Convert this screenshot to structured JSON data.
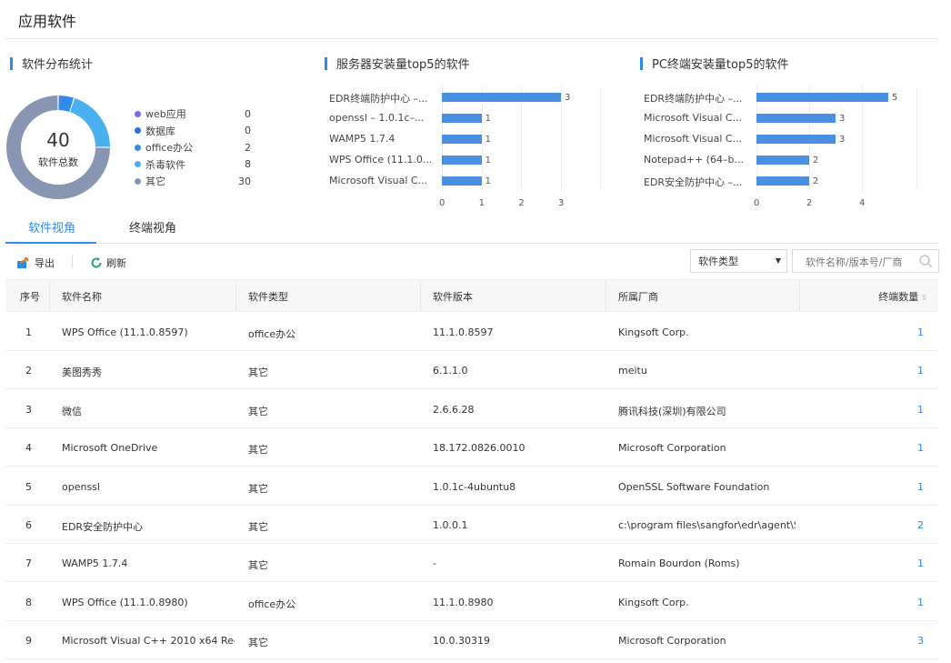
{
  "page": {
    "title": "应用软件"
  },
  "sections": {
    "distribution": "软件分布统计",
    "server_top5": "服务器安装量top5的软件",
    "pc_top5": "PC终端安装量top5的软件"
  },
  "donut": {
    "total": "40",
    "total_label": "软件总数"
  },
  "chart_data": [
    {
      "type": "pie",
      "categories": [
        "web应用",
        "数据库",
        "office办公",
        "杀毒软件",
        "其它"
      ],
      "values": [
        0,
        0,
        2,
        8,
        30
      ],
      "colors": [
        "#7b6cd9",
        "#2f6fd6",
        "#2f8be6",
        "#4ab0f0",
        "#8896b3"
      ],
      "legend_position": "right"
    },
    {
      "type": "bar",
      "orientation": "horizontal",
      "categories": [
        "EDR终端防护中心 –...",
        "openssl – 1.0.1c–...",
        "WAMP5 1.7.4",
        "WPS Office (11.1.0...",
        "Microsoft Visual C..."
      ],
      "values": [
        3,
        1,
        1,
        1,
        1
      ],
      "xlim": [
        0,
        3
      ],
      "xticks": [
        "0",
        "1",
        "2",
        "3"
      ],
      "color": "#4a90e2"
    },
    {
      "type": "bar",
      "orientation": "horizontal",
      "categories": [
        "EDR终端防护中心 –...",
        "Microsoft Visual C...",
        "Microsoft Visual C...",
        "Notepad++ (64–b...",
        "EDR安全防护中心 –..."
      ],
      "values": [
        5,
        3,
        3,
        2,
        2
      ],
      "xlim": [
        0,
        5
      ],
      "xticks": [
        "0",
        "2",
        "4"
      ],
      "color": "#4a90e2"
    }
  ],
  "tabs": [
    {
      "label": "软件视角",
      "active": true
    },
    {
      "label": "终端视角",
      "active": false
    }
  ],
  "toolbar": {
    "export_label": "导出",
    "refresh_label": "刷新",
    "type_select_value": "软件类型",
    "search_placeholder": "软件名称/版本号/厂商"
  },
  "table": {
    "headers": [
      "序号",
      "软件名称",
      "软件类型",
      "软件版本",
      "所属厂商",
      "终端数量"
    ],
    "rows": [
      [
        "1",
        "WPS Office (11.1.0.8597)",
        "office办公",
        "11.1.0.8597",
        "Kingsoft Corp.",
        "1"
      ],
      [
        "2",
        "美图秀秀",
        "其它",
        "6.1.1.0",
        "meitu",
        "1"
      ],
      [
        "3",
        "微信",
        "其它",
        "2.6.6.28",
        "腾讯科技(深圳)有限公司",
        "1"
      ],
      [
        "4",
        "Microsoft OneDrive",
        "其它",
        "18.172.0826.0010",
        "Microsoft Corporation",
        "1"
      ],
      [
        "5",
        "openssl",
        "其它",
        "1.0.1c-4ubuntu8",
        "OpenSSL Software Foundation",
        "1"
      ],
      [
        "6",
        "EDR安全防护中心",
        "其它",
        "1.0.0.1",
        "c:\\program files\\sangfor\\edr\\agent\\S...",
        "2"
      ],
      [
        "7",
        "WAMP5 1.7.4",
        "其它",
        "-",
        "Romain Bourdon (Roms)",
        "1"
      ],
      [
        "8",
        "WPS Office (11.1.0.8980)",
        "office办公",
        "11.1.0.8980",
        "Kingsoft Corp.",
        "1"
      ],
      [
        "9",
        "Microsoft Visual C++ 2010 x64 Redi...",
        "其它",
        "10.0.30319",
        "Microsoft Corporation",
        "3"
      ]
    ]
  }
}
